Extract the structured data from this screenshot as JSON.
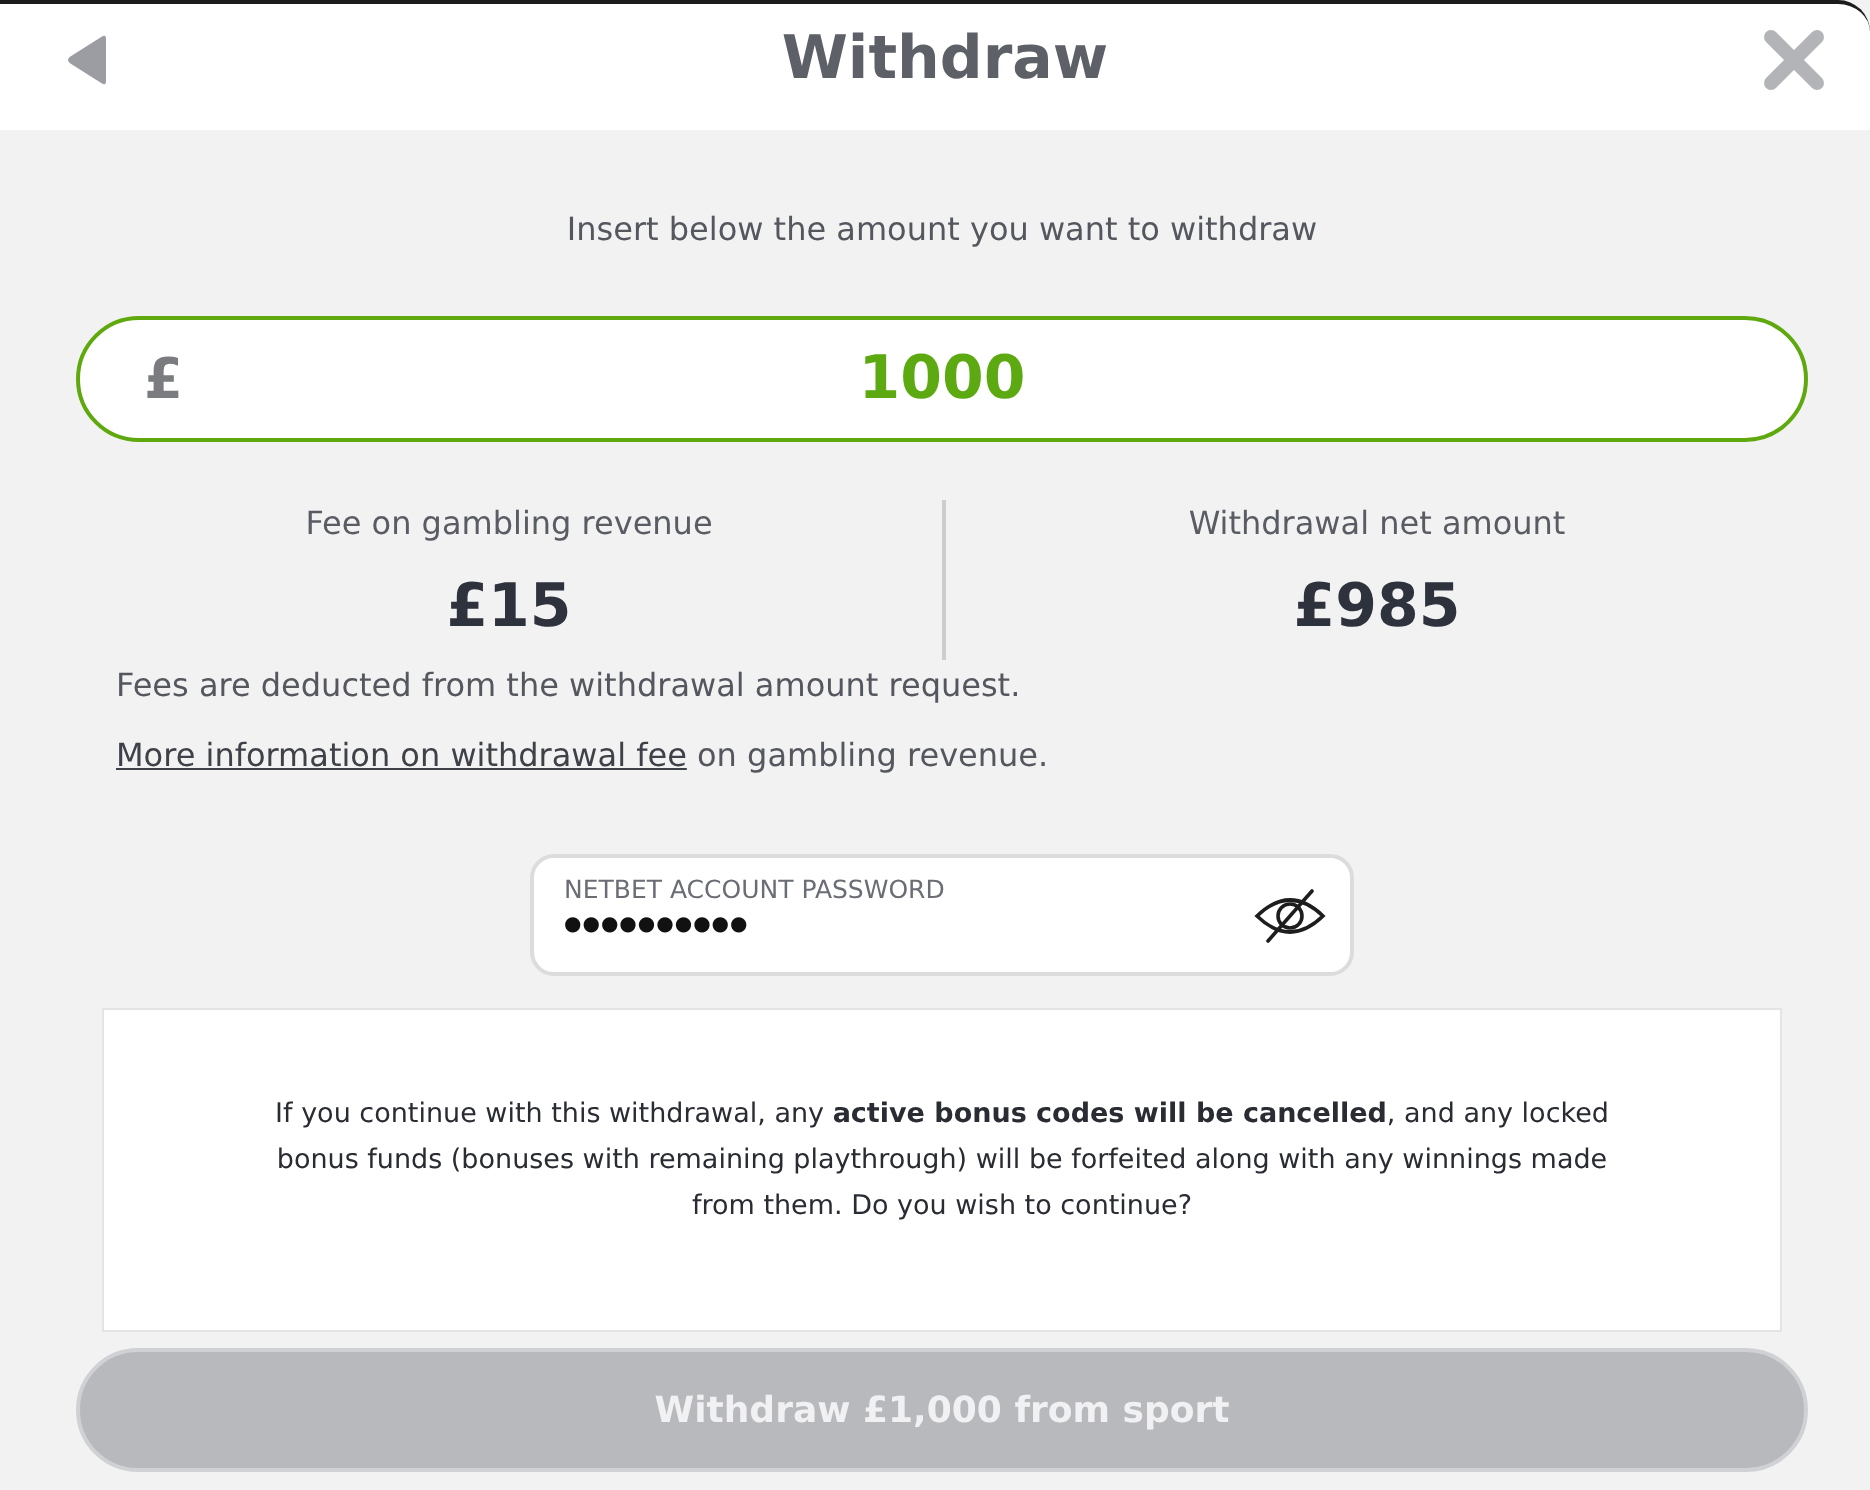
{
  "header": {
    "title": "Withdraw"
  },
  "amount": {
    "prompt": "Insert below the amount you want to withdraw",
    "currency": "£",
    "value": "1000"
  },
  "fees": [
    {
      "label": "Fee on gambling revenue",
      "value": "£15"
    },
    {
      "label": "Withdrawal net amount",
      "value": "£985"
    }
  ],
  "fee_note": "Fees are deducted from the withdrawal amount request.",
  "more_info": {
    "link": "More information on withdrawal fee",
    "text": "on gambling revenue."
  },
  "password": {
    "label": "NETBET ACCOUNT PASSWORD",
    "value": "●●●●●●●●●●"
  },
  "warning": "If you continue with this withdrawal, any **active bonus codes will be cancelled**, and any locked bonus funds (bonuses with remaining playthrough) will be forfeited along with any winnings made from them. Do you wish to continue?",
  "submit_button": {
    "label": "Withdraw £1,000 from sport",
    "disabled": true
  }
}
